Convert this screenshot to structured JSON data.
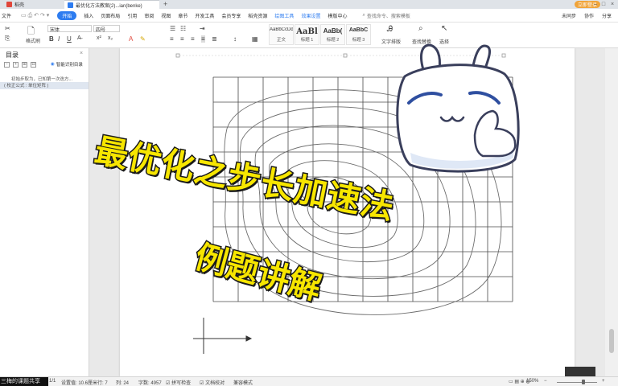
{
  "window": {
    "tabs": [
      {
        "label": "稻壳",
        "color": "#e0463a"
      },
      {
        "label": "最优化方法教案(2)...ian(benke)",
        "color": "#2d7cf0"
      }
    ],
    "login_label": "立即登录",
    "min": "–",
    "max": "□",
    "close": "×"
  },
  "menu": {
    "file": "文件",
    "items": [
      "开始",
      "插入",
      "页面布局",
      "引用",
      "审阅",
      "视图",
      "章节",
      "开发工具",
      "会员专享",
      "稻壳资源"
    ],
    "tools": [
      "绘图工具",
      "效果设置",
      "模版中心"
    ],
    "search": "查找命令、搜索模板",
    "actions": [
      "未同步",
      "协作",
      "分享"
    ]
  },
  "ribbon": {
    "format_painter": "格式刷",
    "clipboard": "剪贴",
    "font_name": "宋体",
    "font_size": "四号",
    "bold": "B",
    "italic": "I",
    "underline": "U",
    "styles": [
      {
        "preview": "AaBbCcDd",
        "name": "正文"
      },
      {
        "preview": "AaBl",
        "name": "标题 1"
      },
      {
        "preview": "AaBb(",
        "name": "标题 2"
      },
      {
        "preview": "AaBbC",
        "name": "标题 3"
      }
    ],
    "text_layout": "文字排版",
    "find_replace": "查找替换",
    "select": "选择"
  },
  "outline": {
    "title": "目录",
    "smart_toc": "智能识别目录",
    "entries": [
      "初始步取为，已知第一次迭方...",
      "( 校正公式 : 单位矩阵 )"
    ]
  },
  "video_overlay": {
    "line1": "最优化之步长加速法",
    "line2": "例题讲解",
    "bottom_left": "三梅的课题共享"
  },
  "statusbar": {
    "page": "1/1",
    "setting": "设置值: 10.6厘米",
    "row": "行: 7",
    "col": "列: 24",
    "words": "字数: 4957",
    "spell": "拼写检查",
    "proof": "文档校对",
    "mode": "兼容模式",
    "zoom": "150%"
  },
  "colors": {
    "accent": "#2d7cf0",
    "title_fill": "#f7e600",
    "title_stroke": "#1a1a1a",
    "mascot_eye": "#2f4fa0",
    "mascot_outline": "#3a3f5c"
  }
}
